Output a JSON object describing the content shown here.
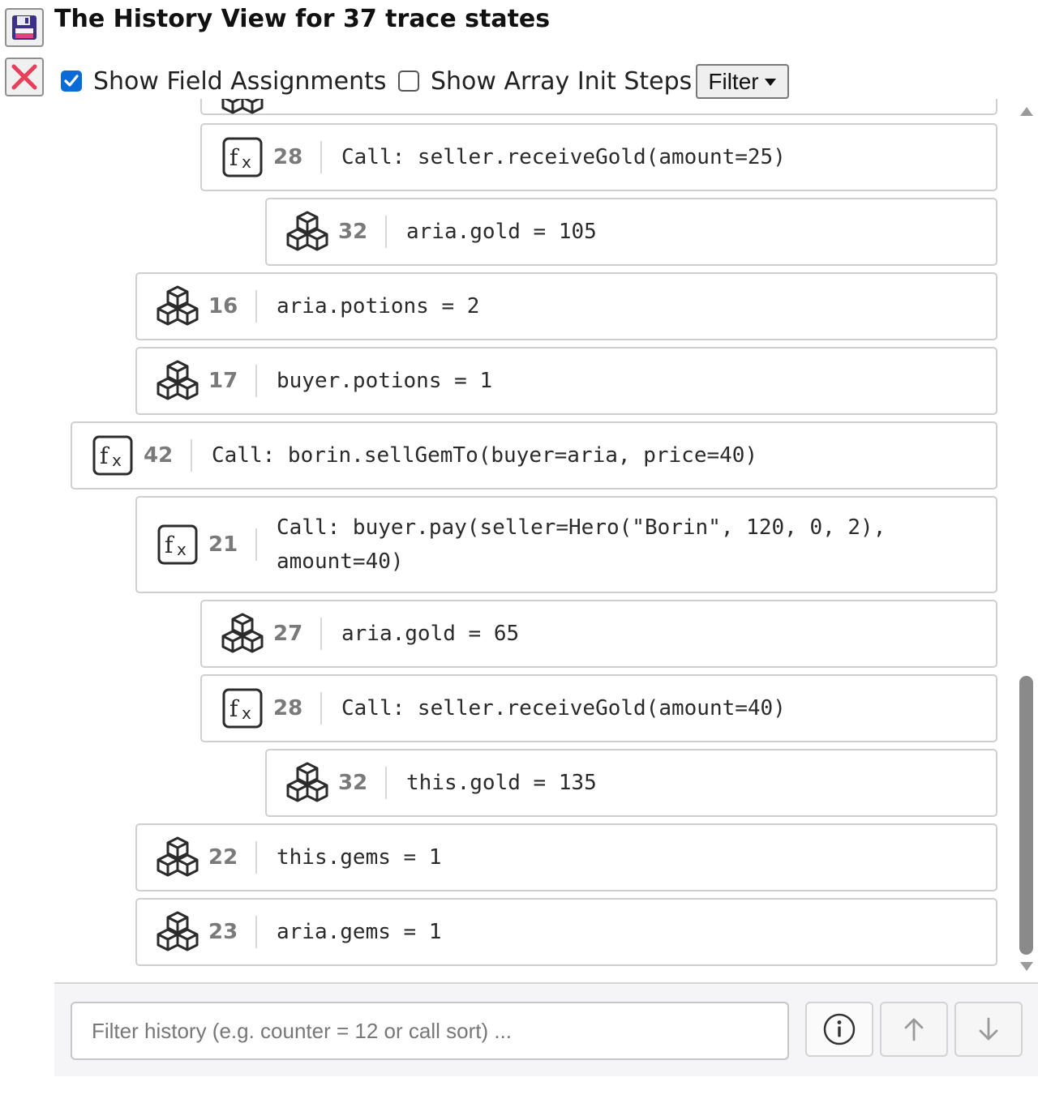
{
  "window": {
    "title": "The History View for 37 trace states",
    "save_icon": "floppy-disk-icon",
    "close_icon": "red-x-icon"
  },
  "options": {
    "show_field_assignments": {
      "label": "Show Field Assignments",
      "checked": true
    },
    "show_array_init_steps": {
      "label": "Show Array Init Steps",
      "checked": false
    },
    "filter_button": "Filter"
  },
  "history": [
    {
      "type": "call",
      "line": "28",
      "text": "Call: seller.receiveGold(amount=25)",
      "depth": 2
    },
    {
      "type": "field",
      "line": "32",
      "text": "aria.gold = 105",
      "depth": 3
    },
    {
      "type": "field",
      "line": "16",
      "text": "aria.potions = 2",
      "depth": 1
    },
    {
      "type": "field",
      "line": "17",
      "text": "buyer.potions = 1",
      "depth": 1
    },
    {
      "type": "call",
      "line": "42",
      "text": "Call: borin.sellGemTo(buyer=aria, price=40)",
      "depth": 0
    },
    {
      "type": "call",
      "line": "21",
      "text": "Call: buyer.pay(seller=Hero(\"Borin\", 120, 0, 2), amount=40)",
      "depth": 1
    },
    {
      "type": "field",
      "line": "27",
      "text": "aria.gold = 65",
      "depth": 2
    },
    {
      "type": "call",
      "line": "28",
      "text": "Call: seller.receiveGold(amount=40)",
      "depth": 2
    },
    {
      "type": "field",
      "line": "32",
      "text": "this.gold = 135",
      "depth": 3
    },
    {
      "type": "field",
      "line": "22",
      "text": "this.gems = 1",
      "depth": 1
    },
    {
      "type": "field",
      "line": "23",
      "text": "aria.gems = 1",
      "depth": 1
    }
  ],
  "search": {
    "placeholder": "Filter history (e.g. counter = 12 or call sort) ...",
    "value": ""
  },
  "buttons": {
    "info_icon": "info-circle-icon",
    "up_icon": "arrow-up-icon",
    "down_icon": "arrow-down-icon"
  },
  "colors": {
    "checkbox_accent": "#0a6bd8",
    "close_x": "#e8405a",
    "scroll_thumb": "#8a8a8a"
  }
}
